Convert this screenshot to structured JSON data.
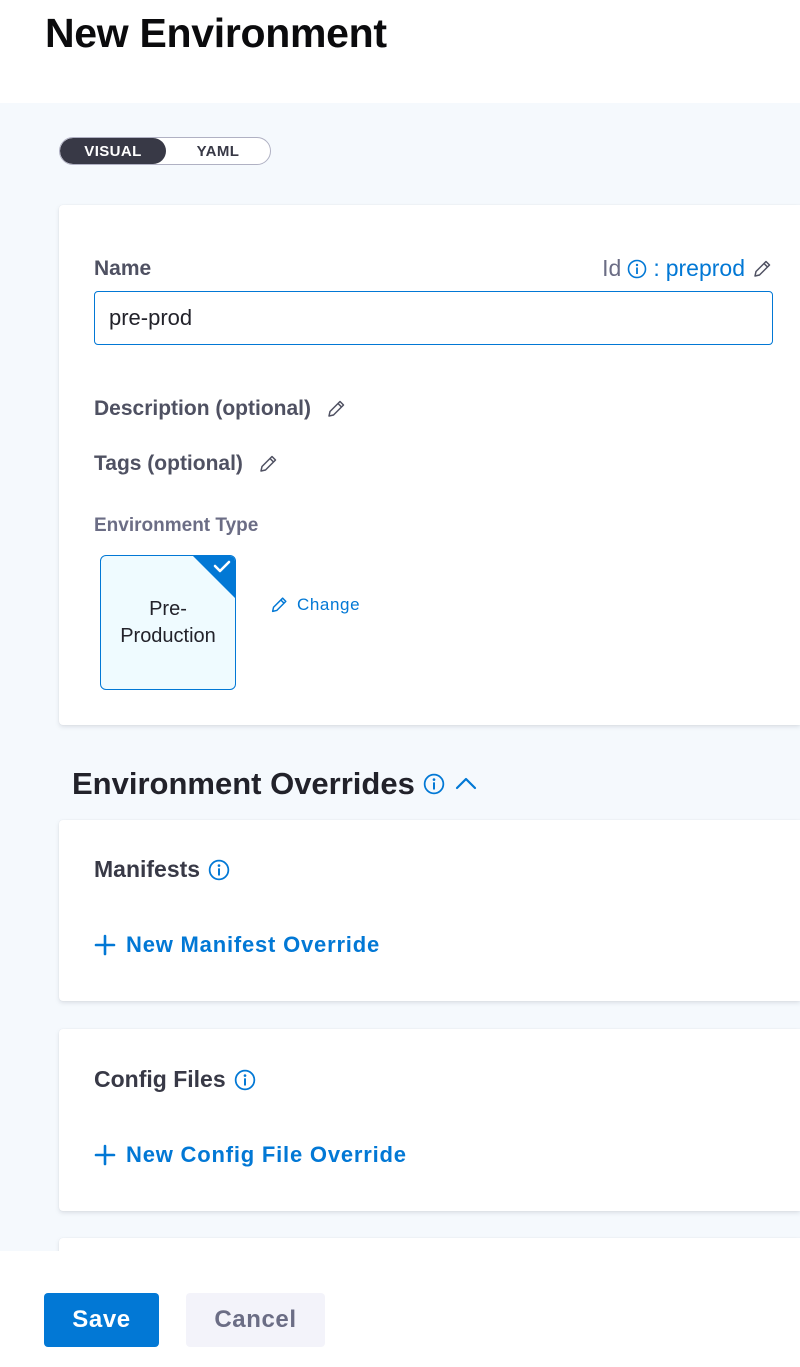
{
  "page": {
    "title": "New Environment"
  },
  "view_toggle": {
    "options": [
      "VISUAL",
      "YAML"
    ],
    "selected": "VISUAL"
  },
  "form": {
    "name_label": "Name",
    "id_label": "Id",
    "id_separator": ":",
    "id_value": "preprod",
    "name_value": "pre-prod",
    "description_label": "Description (optional)",
    "tags_label": "Tags (optional)",
    "env_type_label": "Environment Type",
    "env_type_value": "Pre-\nProduction",
    "change_label": "Change"
  },
  "overrides": {
    "title": "Environment Overrides",
    "manifests": {
      "title": "Manifests",
      "add_label": "New Manifest Override"
    },
    "config_files": {
      "title": "Config Files",
      "add_label": "New Config File Override"
    }
  },
  "footer": {
    "save_label": "Save",
    "cancel_label": "Cancel"
  },
  "colors": {
    "accent": "#0278d5",
    "toggle_active": "#383946",
    "panel_background": "#f5f9fd",
    "tile_background": "#effbff"
  },
  "icons": {
    "id_info": "info-icon",
    "id_edit": "pencil-icon",
    "description_edit": "pencil-icon",
    "tags_edit": "pencil-icon",
    "tile_selected": "checkmark-icon",
    "change": "pencil-icon",
    "overrides_info": "info-icon",
    "overrides_collapse": "chevron-up-icon",
    "manifests_info": "info-icon",
    "config_info": "info-icon",
    "add": "plus-icon"
  }
}
